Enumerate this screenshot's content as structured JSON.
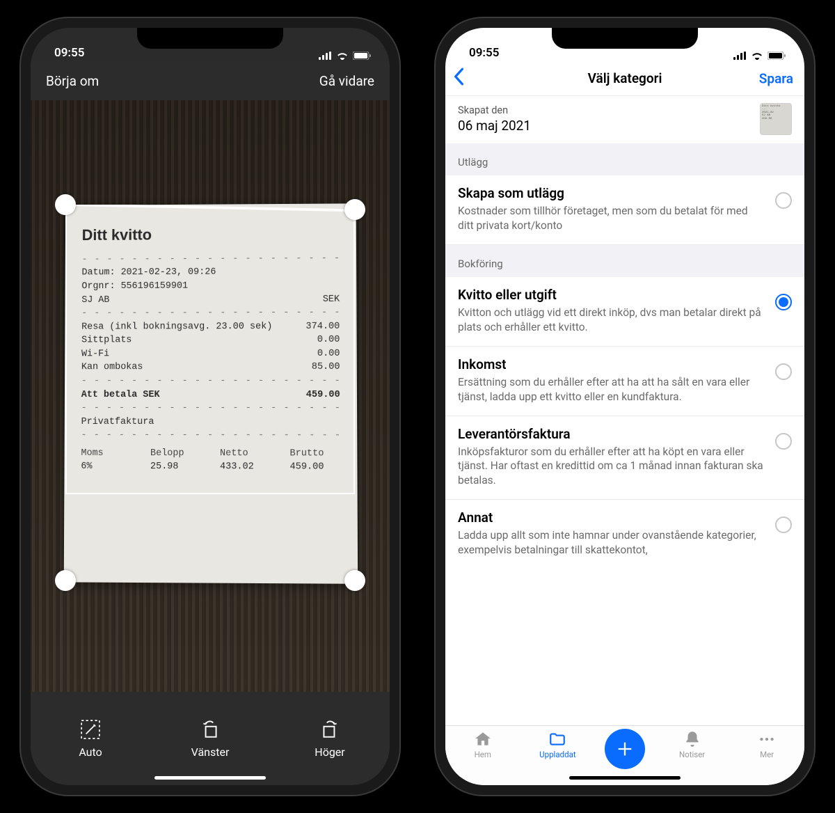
{
  "status": {
    "time": "09:55"
  },
  "scanner": {
    "nav": {
      "restart": "Börja om",
      "continue": "Gå vidare"
    },
    "receipt": {
      "title": "Ditt kvitto",
      "date_line": "Datum: 2021-02-23, 09:26",
      "org_line": "Orgnr: 556196159901",
      "company": "SJ AB",
      "currency": "SEK",
      "items": [
        {
          "label": "Resa (inkl bokningsavg. 23.00 sek)",
          "value": "374.00"
        },
        {
          "label": "Sittplats",
          "value": "0.00"
        },
        {
          "label": "Wi-Fi",
          "value": "0.00"
        },
        {
          "label": "Kan ombokas",
          "value": "85.00"
        }
      ],
      "total_label": "Att betala SEK",
      "total_value": "459.00",
      "private": "Privatfaktura",
      "cols": {
        "moms": "Moms",
        "belopp": "Belopp",
        "netto": "Netto",
        "brutto": "Brutto",
        "moms_v": "6%",
        "belopp_v": "25.98",
        "netto_v": "433.02",
        "brutto_v": "459.00"
      }
    },
    "tools": {
      "auto": "Auto",
      "left": "Vänster",
      "right": "Höger"
    }
  },
  "category": {
    "nav": {
      "title": "Välj kategori",
      "save": "Spara"
    },
    "created": {
      "label": "Skapat den",
      "date": "06 maj 2021"
    },
    "sections": {
      "utlagg_hdr": "Utlägg",
      "bokforing_hdr": "Bokföring"
    },
    "options": {
      "utlagg": {
        "title": "Skapa som utlägg",
        "desc": "Kostnader som tillhör företaget, men som du betalat för med ditt privata kort/konto"
      },
      "kvitto": {
        "title": "Kvitto eller utgift",
        "desc": "Kvitton och utlägg vid ett direkt inköp, dvs man betalar direkt på plats och erhåller ett kvitto."
      },
      "inkomst": {
        "title": "Inkomst",
        "desc": "Ersättning som du erhåller efter att ha att ha sålt en vara eller tjänst, ladda upp ett kvitto eller en kundfaktura."
      },
      "lev": {
        "title": "Leverantörsfaktura",
        "desc": "Inköpsfakturor som du erhåller efter att ha köpt en vara eller tjänst. Har oftast en kredittid om ca 1 månad innan fakturan ska betalas."
      },
      "annat": {
        "title": "Annat",
        "desc": "Ladda upp allt som inte hamnar under ovanstående kategorier, exempelvis betalningar till skattekontot,"
      }
    },
    "tabs": {
      "home": "Hem",
      "uploaded": "Uppladdat",
      "notifications": "Notiser",
      "more": "Mer"
    }
  }
}
